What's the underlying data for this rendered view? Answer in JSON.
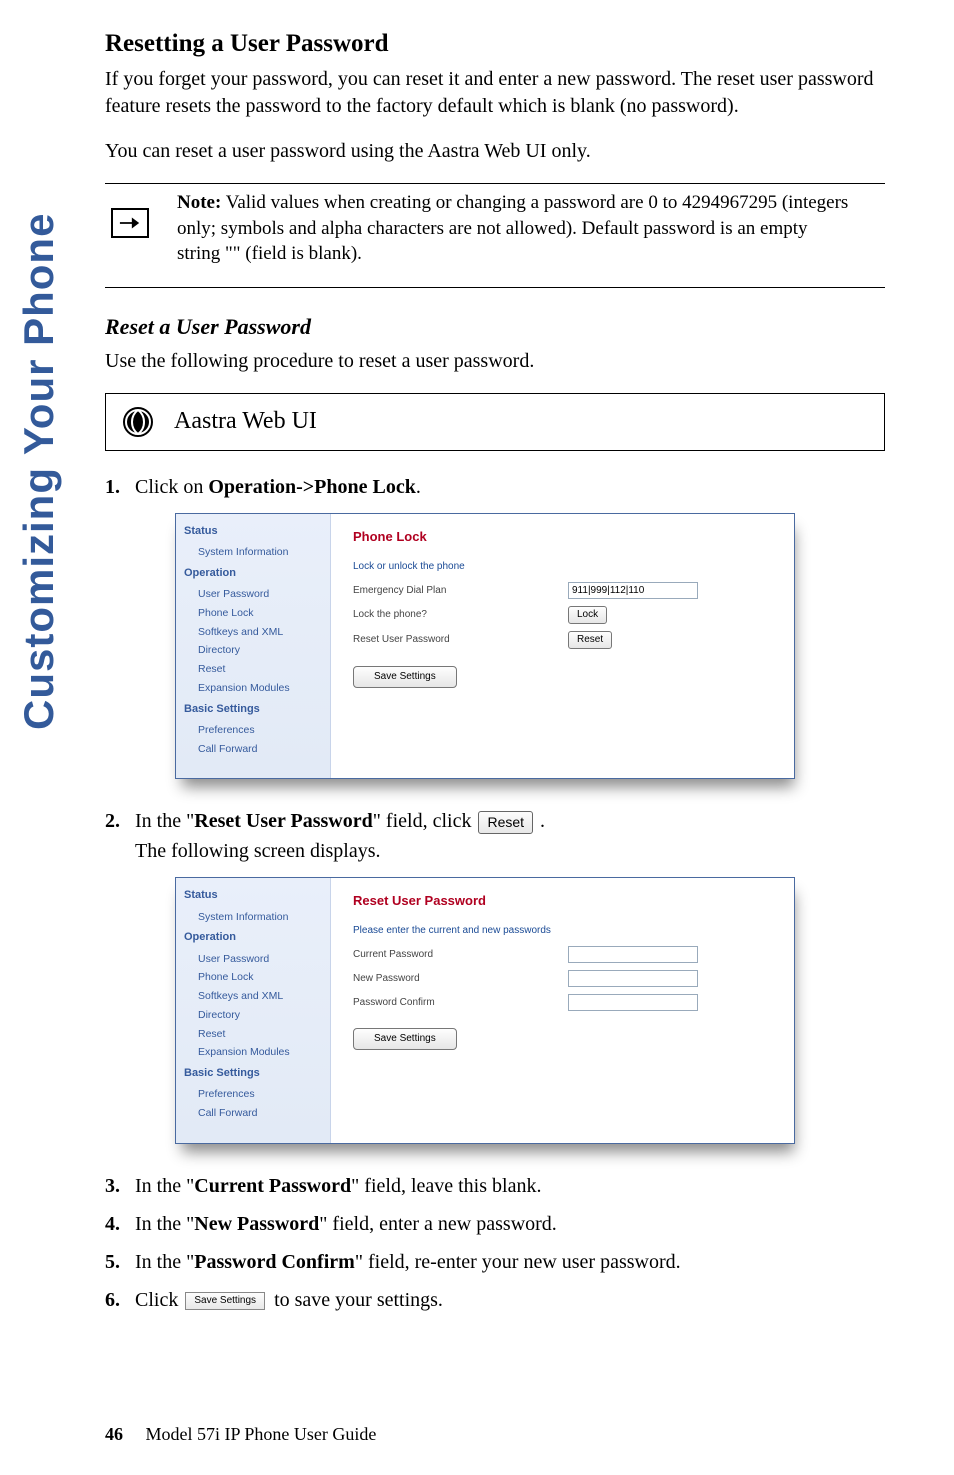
{
  "side_tab": "Customizing Your Phone",
  "h2": "Resetting a User Password",
  "intro1": "If you forget your password, you can reset it and enter a new password. The reset user password feature resets the password to the factory default which is blank (no password).",
  "intro2": "You can reset a user password using the Aastra Web UI only.",
  "note_label": "Note:",
  "note_text": " Valid values when creating or changing a password are 0 to 4294967295 (integers only; symbols and alpha characters are not allowed). Default password is an empty string \"\" (field is blank).",
  "h3": "Reset a User Password",
  "intro3": "Use the following procedure to reset a user password.",
  "webui_label": "Aastra Web UI",
  "steps": {
    "s1a": "Click on ",
    "s1b": "Operation->Phone Lock",
    "s1c": ".",
    "s2a": "In the \"",
    "s2b": "Reset User Password",
    "s2c": "\" field, click ",
    "s2btn": "Reset",
    "s2d": " .",
    "s2sub": "The following screen displays.",
    "s3a": "In the \"",
    "s3b": "Current Password",
    "s3c": "\" field, leave this blank.",
    "s4a": "In the \"",
    "s4b": "New Password",
    "s4c": "\" field, enter a new password.",
    "s5a": "In the \"",
    "s5b": "Password Confirm",
    "s5c": "\" field, re-enter your new user password.",
    "s6a": "Click ",
    "s6btn": "Save Settings",
    "s6b": " to save your settings."
  },
  "panel1": {
    "title": "Phone Lock",
    "section": "Lock or unlock the phone",
    "rows": [
      {
        "label": "Emergency Dial Plan",
        "type": "text",
        "value": "911|999|112|110"
      },
      {
        "label": "Lock the phone?",
        "type": "button",
        "value": "Lock"
      },
      {
        "label": "Reset User Password",
        "type": "button",
        "value": "Reset"
      }
    ],
    "save": "Save Settings"
  },
  "panel2": {
    "title": "Reset User Password",
    "section": "Please enter the current and new passwords",
    "rows": [
      {
        "label": "Current Password"
      },
      {
        "label": "New Password"
      },
      {
        "label": "Password Confirm"
      }
    ],
    "save": "Save Settings"
  },
  "nav": {
    "groups": [
      "Status",
      "Operation",
      "Basic Settings"
    ],
    "status_items": [
      "System Information"
    ],
    "operation_items": [
      "User Password",
      "Phone Lock",
      "Softkeys and XML",
      "Directory",
      "Reset",
      "Expansion Modules"
    ],
    "basic_items": [
      "Preferences",
      "Call Forward"
    ]
  },
  "footer": {
    "page": "46",
    "title": "Model 57i IP Phone User Guide"
  }
}
